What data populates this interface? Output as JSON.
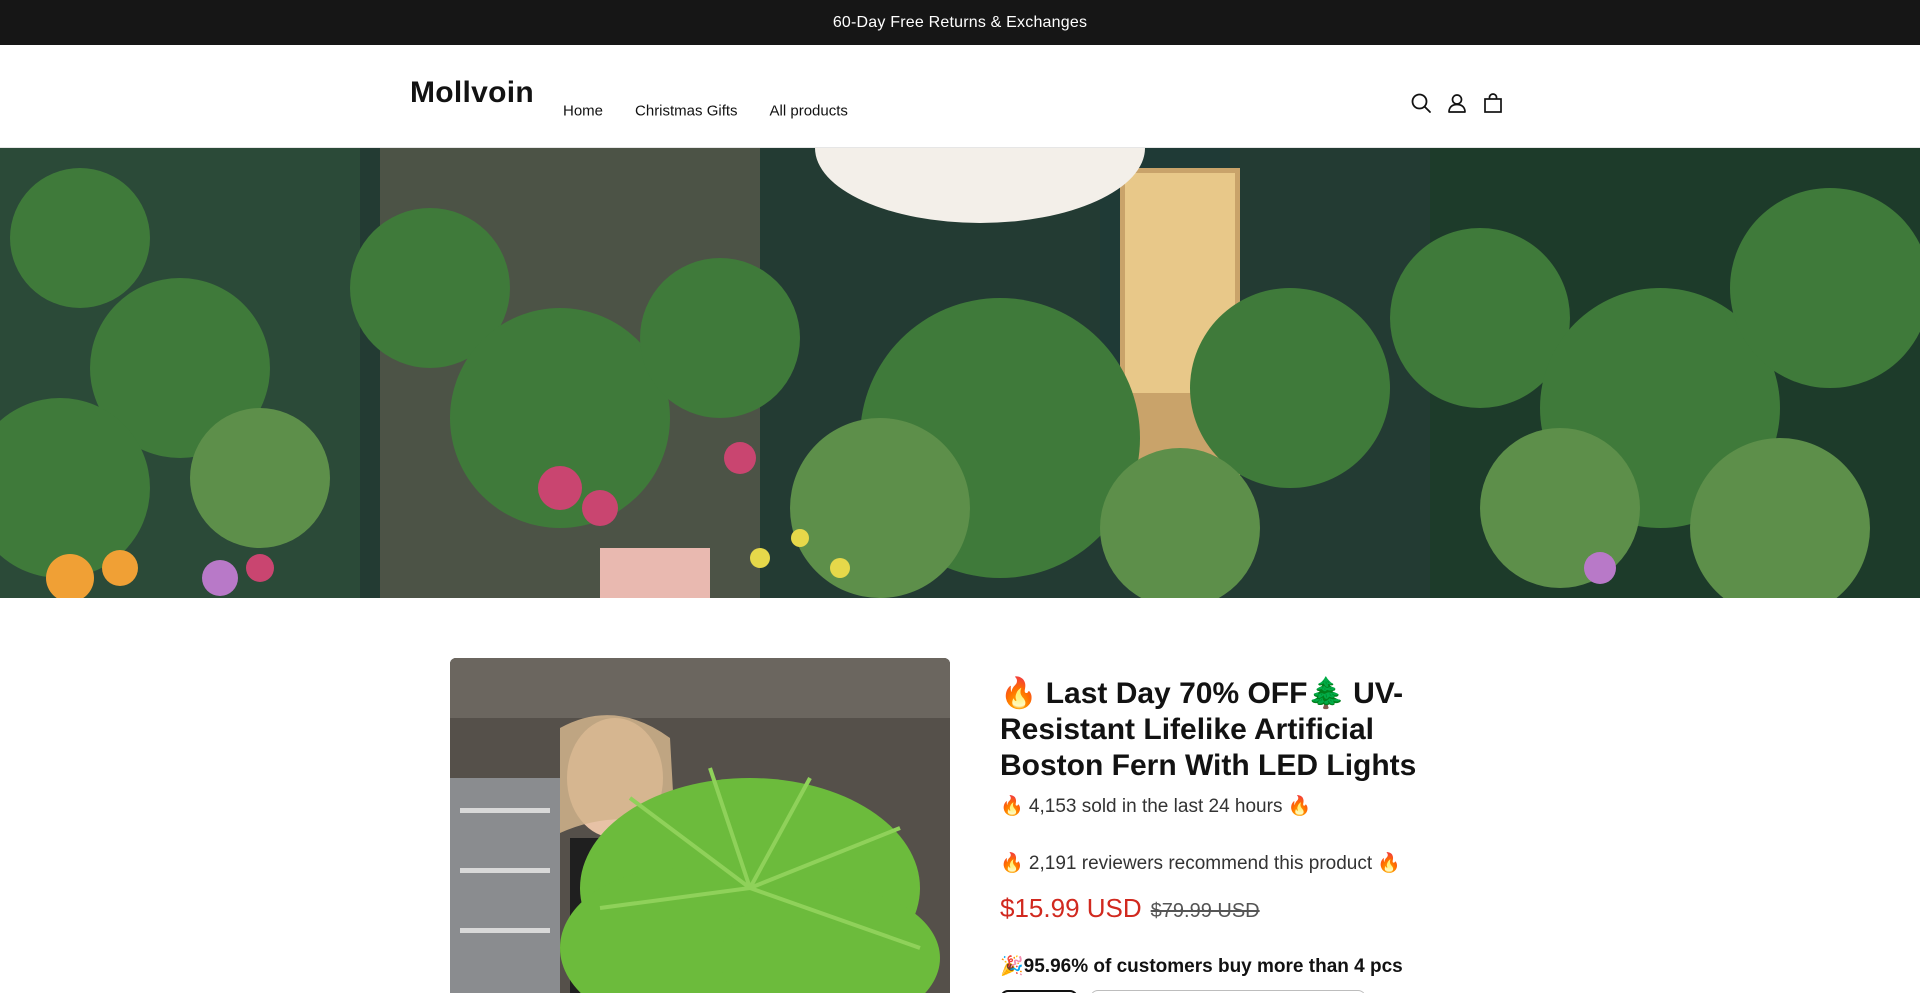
{
  "announcement": {
    "text": "60-Day Free Returns & Exchanges"
  },
  "header": {
    "logo": "Mollvoin",
    "nav": [
      {
        "label": "Home"
      },
      {
        "label": "Christmas Gifts"
      },
      {
        "label": "All products"
      }
    ],
    "icons": [
      "search-icon",
      "account-icon",
      "cart-icon"
    ]
  },
  "product": {
    "title": "🔥 Last Day 70% OFF🌲 UV-Resistant Lifelike Artificial Boston Fern With LED Lights",
    "sold": "🔥 4,153 sold in the last 24 hours 🔥",
    "reviewers": "🔥 2,191 reviewers recommend this product 🔥",
    "price_sale": "$15.99 USD",
    "price_compare": "$79.99 USD",
    "promo": "🎉95.96% of customers buy more than 4 pcs"
  },
  "colors": {
    "announcement_bg": "#161616",
    "sale_price": "#d1291f"
  }
}
